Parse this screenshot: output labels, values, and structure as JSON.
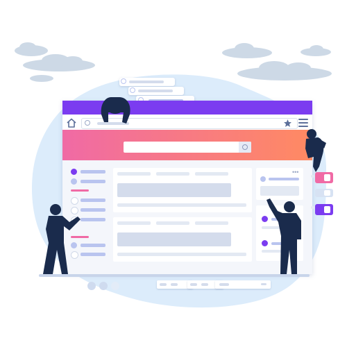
{
  "scene": {
    "type": "illustration",
    "colors": {
      "background": "#ffffff",
      "blob": "#dcecfb",
      "cloud": "#cdd9e6",
      "browser_chrome": "#7b3cf0",
      "hero_gradient_start": "#f06aa5",
      "hero_gradient_end": "#ff8a62",
      "accent_purple": "#7b3cf0",
      "accent_pink": "#f06aa5",
      "skeleton": "#c2cde0",
      "figure": "#1a2b4c"
    },
    "icons": {
      "home": "home-icon",
      "search": "search-icon",
      "star": "star-icon",
      "menu": "hamburger-menu-icon"
    },
    "people_count": 4
  }
}
